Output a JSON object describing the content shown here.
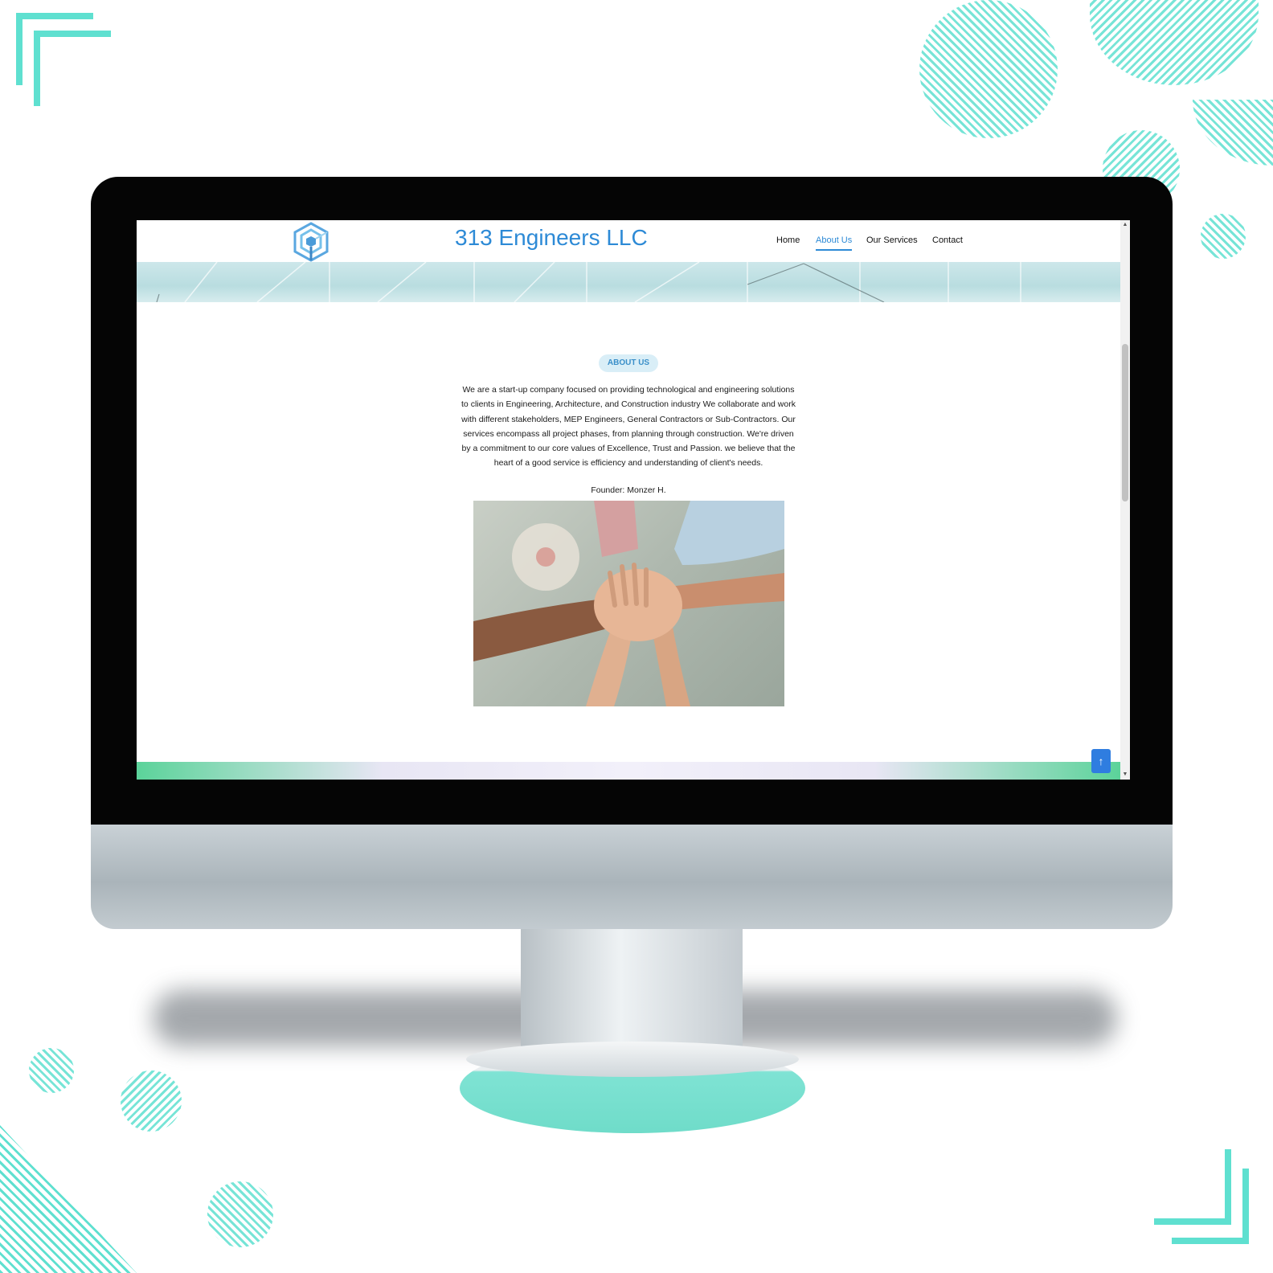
{
  "site": {
    "title": "313 Engineers LLC"
  },
  "nav": {
    "items": [
      "Home",
      "About Us",
      "Our Services",
      "Contact"
    ],
    "active": "About Us"
  },
  "about": {
    "badge": "ABOUT US",
    "body": "We are a start-up company focused on providing technological and engineering solutions to clients in Engineering, Architecture, and Construction industry We collaborate and work with different stakeholders, MEP Engineers, General Contractors or Sub-Contractors. Our services encompass all project phases, from planning through construction. We're driven by a commitment to our core values of Excellence, Trust and Passion. we believe that the heart of a good service is efficiency and understanding of client's needs.",
    "founder": "Founder: Monzer H."
  },
  "icons": {
    "logo": "cube-logo-icon",
    "scroll_top": "arrow-up-icon"
  },
  "colors": {
    "accent": "#2d8ad6",
    "decor": "#5fe0d0",
    "button": "#2f7de0"
  }
}
